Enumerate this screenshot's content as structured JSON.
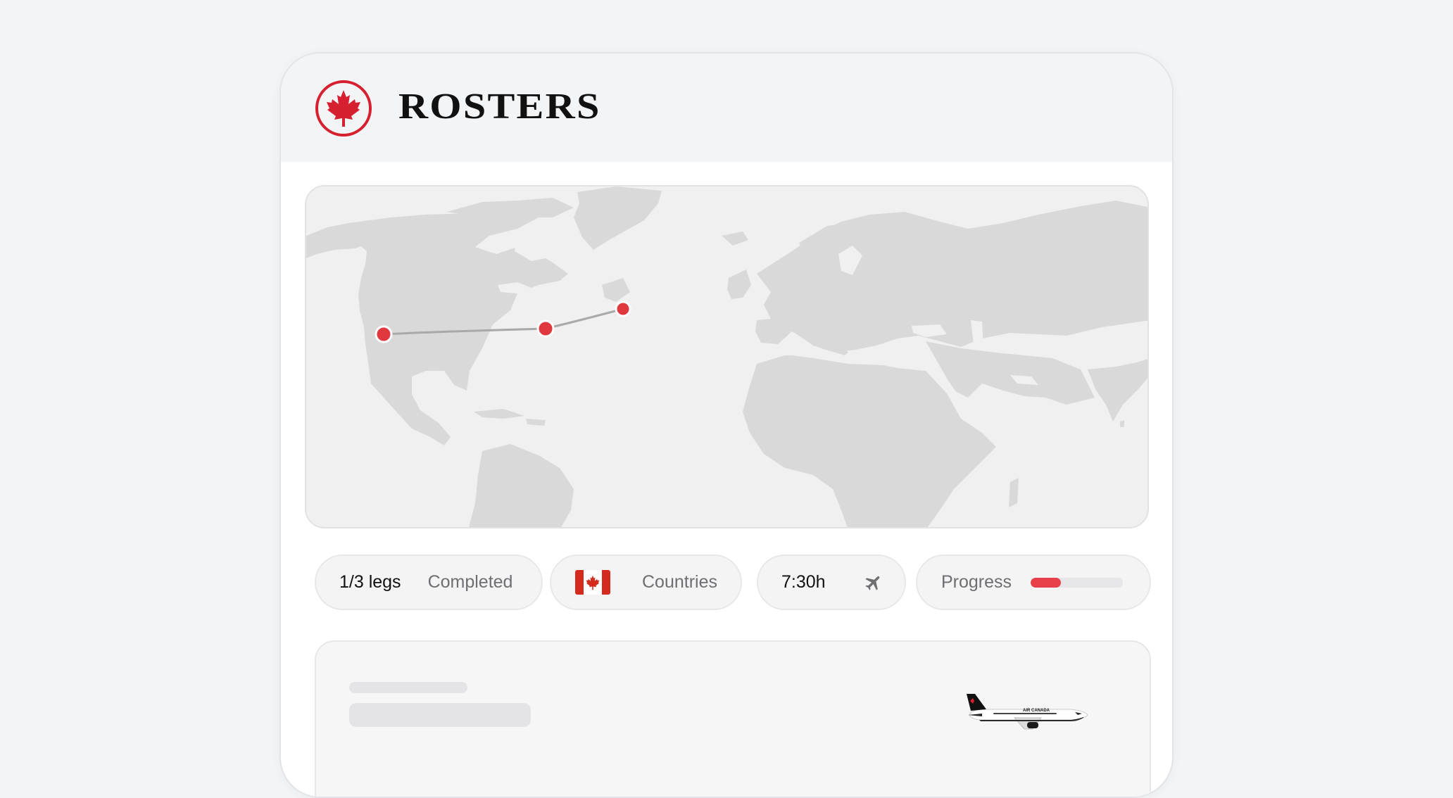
{
  "header": {
    "brand": "ROSTERS",
    "logo_icon": "maple-leaf-icon",
    "accent_color": "#d6202f"
  },
  "map": {
    "land_color": "#d9d9d9",
    "route_color": "#a9a9a9",
    "stop_color": "#e0383f",
    "stops": [
      "san-francisco",
      "toronto",
      "st-johns"
    ]
  },
  "stats": {
    "legs_value": "1/3 legs",
    "legs_label": "Completed",
    "countries_flag": "canada-flag-icon",
    "countries_label": "Countries",
    "duration_value": "7:30h",
    "duration_icon": "airplane-icon",
    "progress_label": "Progress",
    "progress_fraction": 0.33,
    "progress_color": "#e8414c"
  },
  "detail": {
    "aircraft_livery_text": "AIR CANADA"
  }
}
